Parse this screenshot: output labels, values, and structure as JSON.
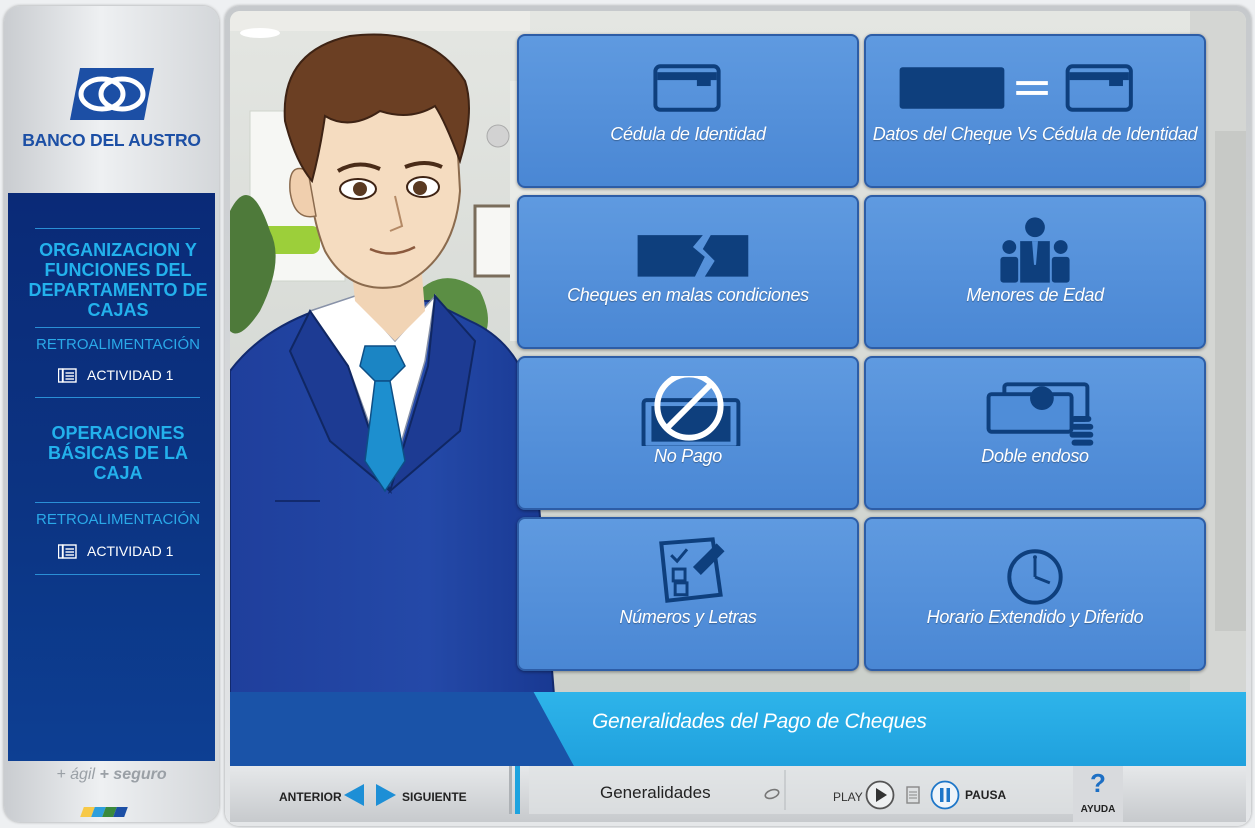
{
  "brand": {
    "name": "BANCO DEL AUSTRO",
    "tagline_light": "+ ágil",
    "tagline_bold": "+ seguro"
  },
  "sidebar": {
    "sections": [
      {
        "title": "ORGANIZACION Y FUNCIONES DEL DEPARTAMENTO DE CAJAS",
        "feedback": "RETROALIMENTACIÓN",
        "activity": "ACTIVIDAD 1"
      },
      {
        "title": "OPERACIONES BÁSICAS DE LA CAJA",
        "feedback": "RETROALIMENTACIÓN",
        "activity": "ACTIVIDAD 1"
      }
    ]
  },
  "tiles": [
    {
      "label": "Cédula de Identidad",
      "icon": "id-card-icon"
    },
    {
      "label": "Datos del Cheque Vs Cédula de Identidad",
      "icon": "cheque-equals-id-icon"
    },
    {
      "label": "Cheques en malas condiciones",
      "icon": "torn-cheque-icon"
    },
    {
      "label": "Menores de Edad",
      "icon": "group-people-icon"
    },
    {
      "label": "No Pago",
      "icon": "no-payment-icon"
    },
    {
      "label": "Doble endoso",
      "icon": "money-stack-icon"
    },
    {
      "label": "Números y Letras",
      "icon": "checklist-icon"
    },
    {
      "label": "Horario Extendido y Diferido",
      "icon": "clock-icon"
    }
  ],
  "topic_title": "Generalidades del Pago de Cheques",
  "controls": {
    "prev_label": "ANTERIOR",
    "next_label": "SIGUIENTE",
    "section_name": "Generalidades",
    "play_label": "PLAY",
    "pause_label": "PAUSA",
    "help_symbol": "?",
    "help_label": "AYUDA"
  },
  "colors": {
    "accent": "#1fa0dd",
    "tile": "#4f8dd8",
    "menu": "#0c3483",
    "icon_dark": "#0e3f7d"
  }
}
